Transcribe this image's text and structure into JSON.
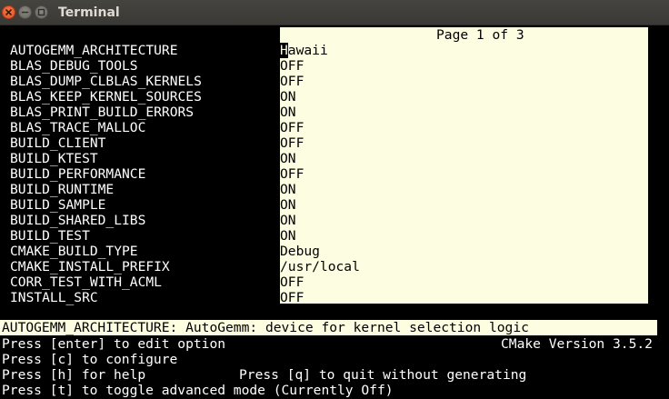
{
  "window": {
    "title": "Terminal"
  },
  "cmake": {
    "page_indicator": "Page 1 of 3",
    "options": [
      {
        "name": "AUTOGEMM_ARCHITECTURE",
        "value": "Hawaii",
        "selected": true
      },
      {
        "name": "BLAS_DEBUG_TOOLS",
        "value": "OFF"
      },
      {
        "name": "BLAS_DUMP_CLBLAS_KERNELS",
        "value": "OFF"
      },
      {
        "name": "BLAS_KEEP_KERNEL_SOURCES",
        "value": "ON"
      },
      {
        "name": "BLAS_PRINT_BUILD_ERRORS",
        "value": "ON"
      },
      {
        "name": "BLAS_TRACE_MALLOC",
        "value": "OFF"
      },
      {
        "name": "BUILD_CLIENT",
        "value": "OFF"
      },
      {
        "name": "BUILD_KTEST",
        "value": "ON"
      },
      {
        "name": "BUILD_PERFORMANCE",
        "value": "OFF"
      },
      {
        "name": "BUILD_RUNTIME",
        "value": "ON"
      },
      {
        "name": "BUILD_SAMPLE",
        "value": "ON"
      },
      {
        "name": "BUILD_SHARED_LIBS",
        "value": "ON"
      },
      {
        "name": "BUILD_TEST",
        "value": "ON"
      },
      {
        "name": "CMAKE_BUILD_TYPE",
        "value": "Debug"
      },
      {
        "name": "CMAKE_INSTALL_PREFIX",
        "value": "/usr/local"
      },
      {
        "name": "CORR_TEST_WITH_ACML",
        "value": "OFF"
      },
      {
        "name": "INSTALL_SRC",
        "value": "OFF"
      }
    ],
    "help_text": "AUTOGEMM_ARCHITECTURE: AutoGemm: device for kernel selection logic",
    "footer": {
      "line1": "Press [enter] to edit option",
      "version": "CMake Version 3.5.2",
      "line2": "Press [c] to configure",
      "line3": "Press [h] for help",
      "quit": "Press [q] to quit without generating",
      "line4": "Press [t] to toggle advanced mode (Currently Off)"
    }
  },
  "colors": {
    "background": "#000000",
    "panel": "#fdfde1",
    "text": "#ffffff",
    "close_button": "#e95420"
  },
  "icons": {
    "close": "close-icon",
    "minimize": "minimize-icon",
    "maximize": "maximize-icon"
  }
}
